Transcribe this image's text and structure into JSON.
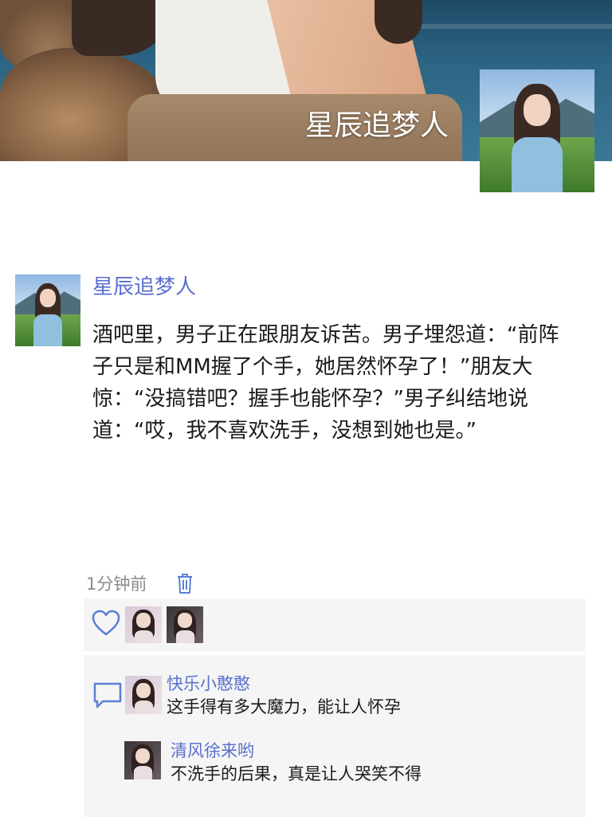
{
  "cover": {
    "username": "星辰追梦人"
  },
  "post": {
    "author": "星辰追梦人",
    "text": "酒吧里，男子正在跟朋友诉苦。男子埋怨道：“前阵子只是和MM握了个手，她居然怀孕了！”朋友大惊：“没搞错吧？握手也能怀孕？”男子纠结地说道：“哎，我不喜欢洗手，没想到她也是。”",
    "time": "1分钟前"
  },
  "icons": {
    "delete": "trash-icon",
    "like": "heart-icon",
    "comment": "comment-bubble-icon"
  },
  "comments": [
    {
      "author": "快乐小憨憨",
      "text": "这手得有多大魔力，能让人怀孕"
    },
    {
      "author": "清风徐来哟",
      "text": "不洗手的后果，真是让人哭笑不得"
    }
  ],
  "colors": {
    "name_link": "#5a6fcf",
    "meta_gray": "#8a8a8a",
    "panel_bg": "#f5f5f5"
  }
}
